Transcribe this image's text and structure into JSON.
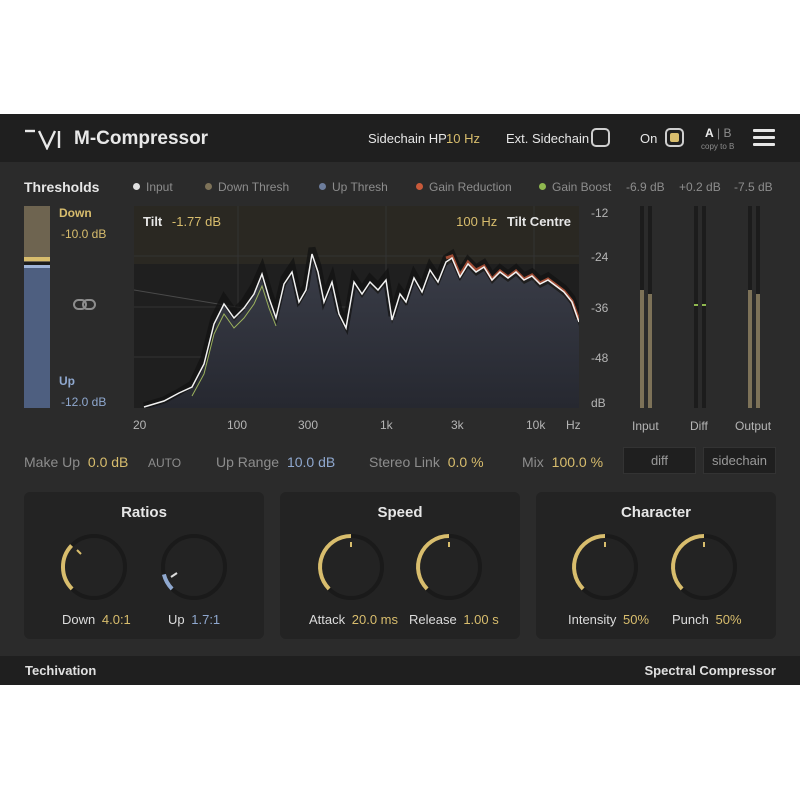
{
  "header": {
    "title": "M-Compressor",
    "sidechain_hp_label": "Sidechain HP",
    "sidechain_hp_value": "10 Hz",
    "ext_sidechain_label": "Ext. Sidechain",
    "on_label": "On",
    "ab_a": "A",
    "ab_sep": "|",
    "ab_b": "B",
    "copy_to_b": "copy to B"
  },
  "thresholds": {
    "title": "Thresholds",
    "down_label": "Down",
    "down_value": "-10.0 dB",
    "up_label": "Up",
    "up_value": "-12.0 dB"
  },
  "legend": [
    {
      "label": "Input",
      "color": "#e0e0e0"
    },
    {
      "label": "Down Thresh",
      "color": "#7d7258"
    },
    {
      "label": "Up Thresh",
      "color": "#6d7d9c"
    },
    {
      "label": "Gain Reduction",
      "color": "#c85a3a"
    },
    {
      "label": "Gain Boost",
      "color": "#8fb84f"
    }
  ],
  "graph": {
    "tilt_label": "Tilt",
    "tilt_value": "-1.77 dB",
    "tilt_centre_value": "100 Hz",
    "tilt_centre_label": "Tilt Centre",
    "y_ticks": [
      "-12",
      "-24",
      "-36",
      "-48",
      "dB"
    ],
    "x_ticks": [
      "20",
      "100",
      "300",
      "1k",
      "3k",
      "10k",
      "Hz"
    ]
  },
  "meters": {
    "input_value": "-6.9 dB",
    "diff_value": "+0.2 dB",
    "output_value": "-7.5 dB",
    "input_label": "Input",
    "diff_label": "Diff",
    "output_label": "Output"
  },
  "params": {
    "makeup_label": "Make Up",
    "makeup_value": "0.0 dB",
    "auto_label": "AUTO",
    "uprange_label": "Up Range",
    "uprange_value": "10.0 dB",
    "stereolink_label": "Stereo Link",
    "stereolink_value": "0.0 %",
    "mix_label": "Mix",
    "mix_value": "100.0 %",
    "diff_button": "diff",
    "sidechain_button": "sidechain"
  },
  "ratios": {
    "title": "Ratios",
    "down_label": "Down",
    "down_value": "4.0:1",
    "up_label": "Up",
    "up_value": "1.7:1"
  },
  "speed": {
    "title": "Speed",
    "attack_label": "Attack",
    "attack_value": "20.0 ms",
    "release_label": "Release",
    "release_value": "1.00 s"
  },
  "character": {
    "title": "Character",
    "intensity_label": "Intensity",
    "intensity_value": "50%",
    "punch_label": "Punch",
    "punch_value": "50%"
  },
  "footer": {
    "brand": "Techivation",
    "product": "Spectral Compressor"
  },
  "colors": {
    "accent_gold": "#d8bd6d",
    "accent_blue": "#8fa8cf",
    "accent_green": "#9fc465",
    "background": "#2b2b2b"
  }
}
